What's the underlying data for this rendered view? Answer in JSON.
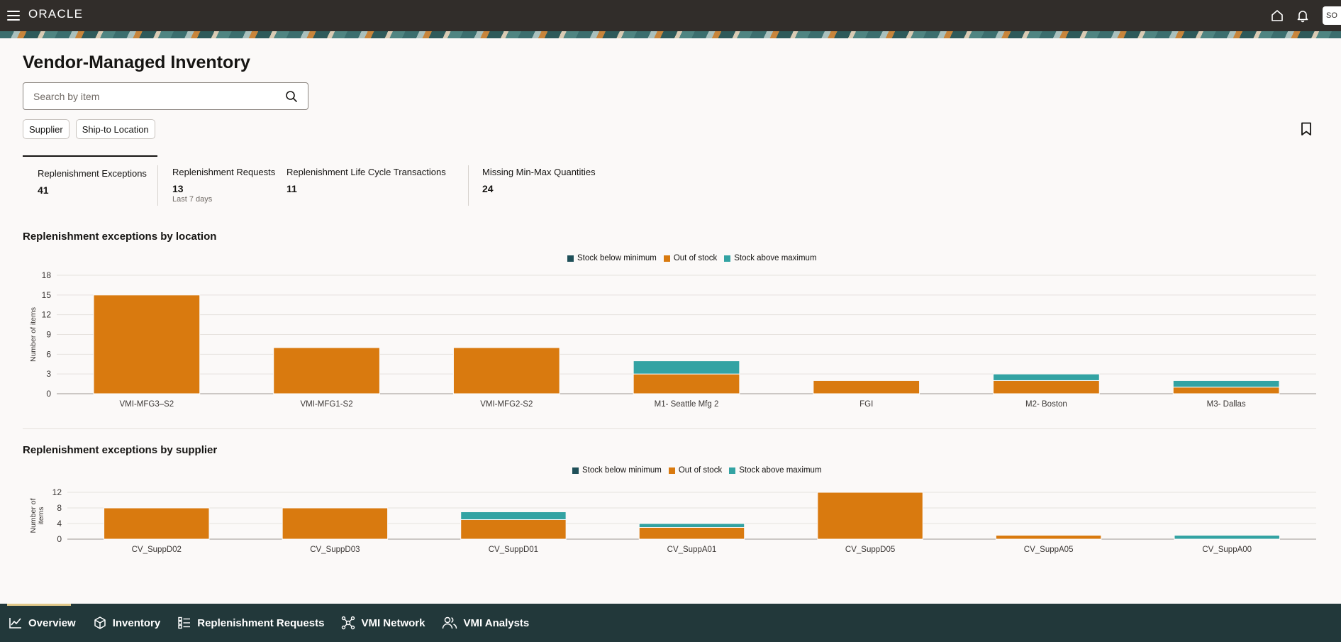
{
  "header": {
    "logo": "ORACLE",
    "avatar_initials": "SO"
  },
  "page": {
    "title": "Vendor-Managed Inventory"
  },
  "search": {
    "placeholder": "Search by item"
  },
  "filters": [
    "Supplier",
    "Ship-to Location"
  ],
  "metrics": [
    {
      "label": "Replenishment Exceptions",
      "value": "41",
      "sub": "",
      "active": true
    },
    {
      "label": "Replenishment Requests",
      "value": "13",
      "sub": "Last 7 days",
      "active": false
    },
    {
      "label": "Replenishment Life Cycle Transactions",
      "value": "11",
      "sub": "",
      "active": false
    },
    {
      "label": "Missing Min-Max Quantities",
      "value": "24",
      "sub": "",
      "active": false
    }
  ],
  "colors": {
    "stock_below_minimum": "#1f5059",
    "out_of_stock": "#d97a0f",
    "stock_above_maximum": "#33a3a3"
  },
  "chart_data": [
    {
      "type": "bar",
      "stacked": true,
      "title": "Replenishment exceptions by location",
      "xlabel": "",
      "ylabel": "Number of items",
      "ylim": [
        0,
        18
      ],
      "yticks": [
        0,
        3,
        6,
        9,
        12,
        15,
        18
      ],
      "legend_position": "top-center",
      "grid": true,
      "categories": [
        "VMI-MFG3–S2",
        "VMI-MFG1-S2",
        "VMI-MFG2-S2",
        "M1- Seattle Mfg 2",
        "FGI",
        "M2- Boston",
        "M3- Dallas"
      ],
      "series": [
        {
          "name": "Stock below minimum",
          "values": [
            0,
            0,
            0,
            0,
            0,
            0,
            0
          ]
        },
        {
          "name": "Out of stock",
          "values": [
            15,
            7,
            7,
            3,
            2,
            2,
            1
          ]
        },
        {
          "name": "Stock above maximum",
          "values": [
            0,
            0,
            0,
            2,
            0,
            1,
            1
          ]
        }
      ]
    },
    {
      "type": "bar",
      "stacked": true,
      "title": "Replenishment exceptions by supplier",
      "xlabel": "",
      "ylabel": "Number of items",
      "ylim": [
        0,
        12
      ],
      "yticks": [
        0,
        4,
        8,
        12
      ],
      "legend_position": "top-center",
      "grid": true,
      "categories": [
        "CV_SuppD02",
        "CV_SuppD03",
        "CV_SuppD01",
        "CV_SuppA01",
        "CV_SuppD05",
        "CV_SuppA05",
        "CV_SuppA00"
      ],
      "series": [
        {
          "name": "Stock below minimum",
          "values": [
            0,
            0,
            0,
            0,
            0,
            0,
            0
          ]
        },
        {
          "name": "Out of stock",
          "values": [
            8,
            8,
            5,
            3,
            12,
            1,
            0
          ]
        },
        {
          "name": "Stock above maximum",
          "values": [
            0,
            0,
            2,
            1,
            0,
            0,
            1
          ]
        }
      ]
    }
  ],
  "bottom_nav": [
    {
      "label": "Overview",
      "icon": "line-chart-icon",
      "active": true
    },
    {
      "label": "Inventory",
      "icon": "cube-icon",
      "active": false
    },
    {
      "label": "Replenishment Requests",
      "icon": "list-icon",
      "active": false
    },
    {
      "label": "VMI Network",
      "icon": "network-icon",
      "active": false
    },
    {
      "label": "VMI Analysts",
      "icon": "users-icon",
      "active": false
    }
  ]
}
